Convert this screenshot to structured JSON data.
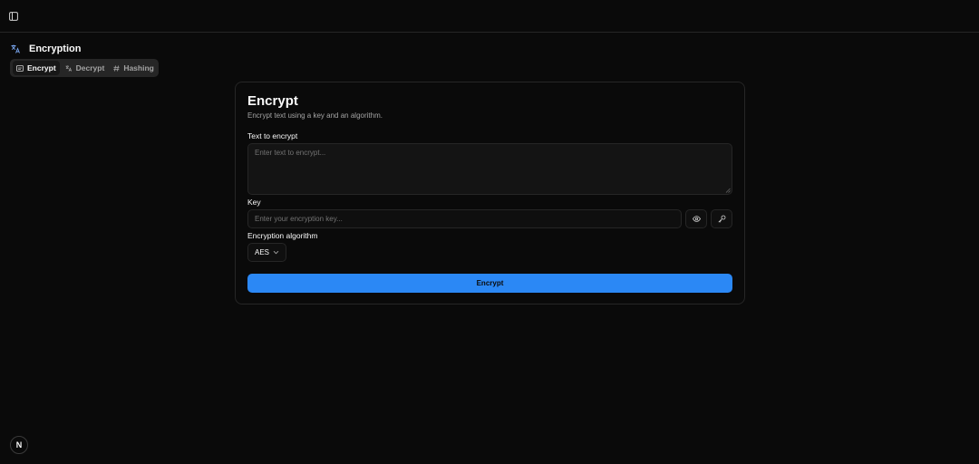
{
  "section": {
    "title": "Encryption",
    "icon": "languages-icon"
  },
  "tabs": [
    {
      "label": "Encrypt",
      "icon": "encrypt-icon",
      "active": true
    },
    {
      "label": "Decrypt",
      "icon": "languages-icon",
      "active": false
    },
    {
      "label": "Hashing",
      "icon": "hash-icon",
      "active": false
    }
  ],
  "card": {
    "title": "Encrypt",
    "description": "Encrypt text using a key and an algorithm.",
    "text_label": "Text to encrypt",
    "text_placeholder": "Enter text to encrypt...",
    "key_label": "Key",
    "key_placeholder": "Enter your encryption key...",
    "algorithm_label": "Encryption algorithm",
    "algorithm_value": "AES",
    "submit_label": "Encrypt"
  },
  "badge": {
    "label": "N"
  },
  "colors": {
    "accent": "#2b88f5",
    "background": "#0a0a0a",
    "border": "#262626"
  }
}
